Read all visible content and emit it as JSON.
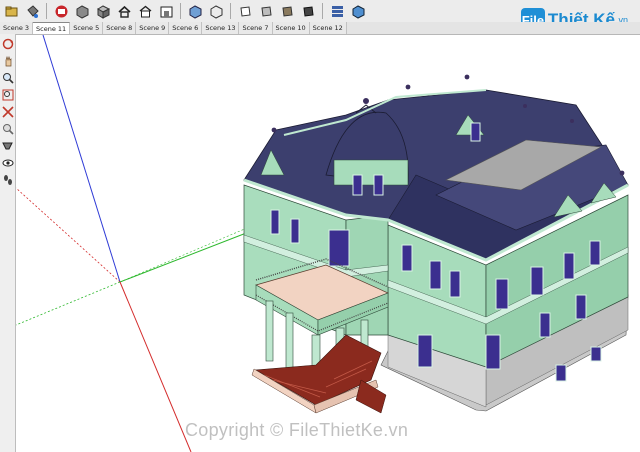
{
  "toolbar": {
    "icons": [
      "open-icon",
      "paint-bucket-icon",
      "warehouse-icon",
      "components-icon",
      "iso-view-icon",
      "house-icon",
      "top-view-icon",
      "front-view-icon",
      "right-view-icon",
      "back-view-icon",
      "left-view-icon",
      "xray-icon",
      "wireframe-icon",
      "hidden-line-icon",
      "shaded-icon",
      "textured-icon",
      "monochrome-icon"
    ]
  },
  "scene_tabs": [
    "Scene 3",
    "Scene 11",
    "Scene 5",
    "Scene 8",
    "Scene 9",
    "Scene 6",
    "Scene 13",
    "Scene 7",
    "Scene 10",
    "Scene 12"
  ],
  "active_tab": "Scene 11",
  "left_tools": [
    "orbit-icon",
    "pan-icon",
    "zoom-icon",
    "zoom-window-icon",
    "zoom-extents-icon",
    "previous-view-icon",
    "position-camera-icon",
    "look-around-icon",
    "walk-icon"
  ],
  "logo": {
    "mark": "File",
    "text": "Thiết Kế",
    "suffix": ".vn"
  },
  "watermark": "Copyright © FileThietKe.vn",
  "colors": {
    "roof": "#3c3f6e",
    "wall": "#a7dcbb",
    "trim": "#cfeedd",
    "window": "#3b2f8f",
    "terrace": "#f2d3c2",
    "stairs": "#8b2a1e"
  }
}
